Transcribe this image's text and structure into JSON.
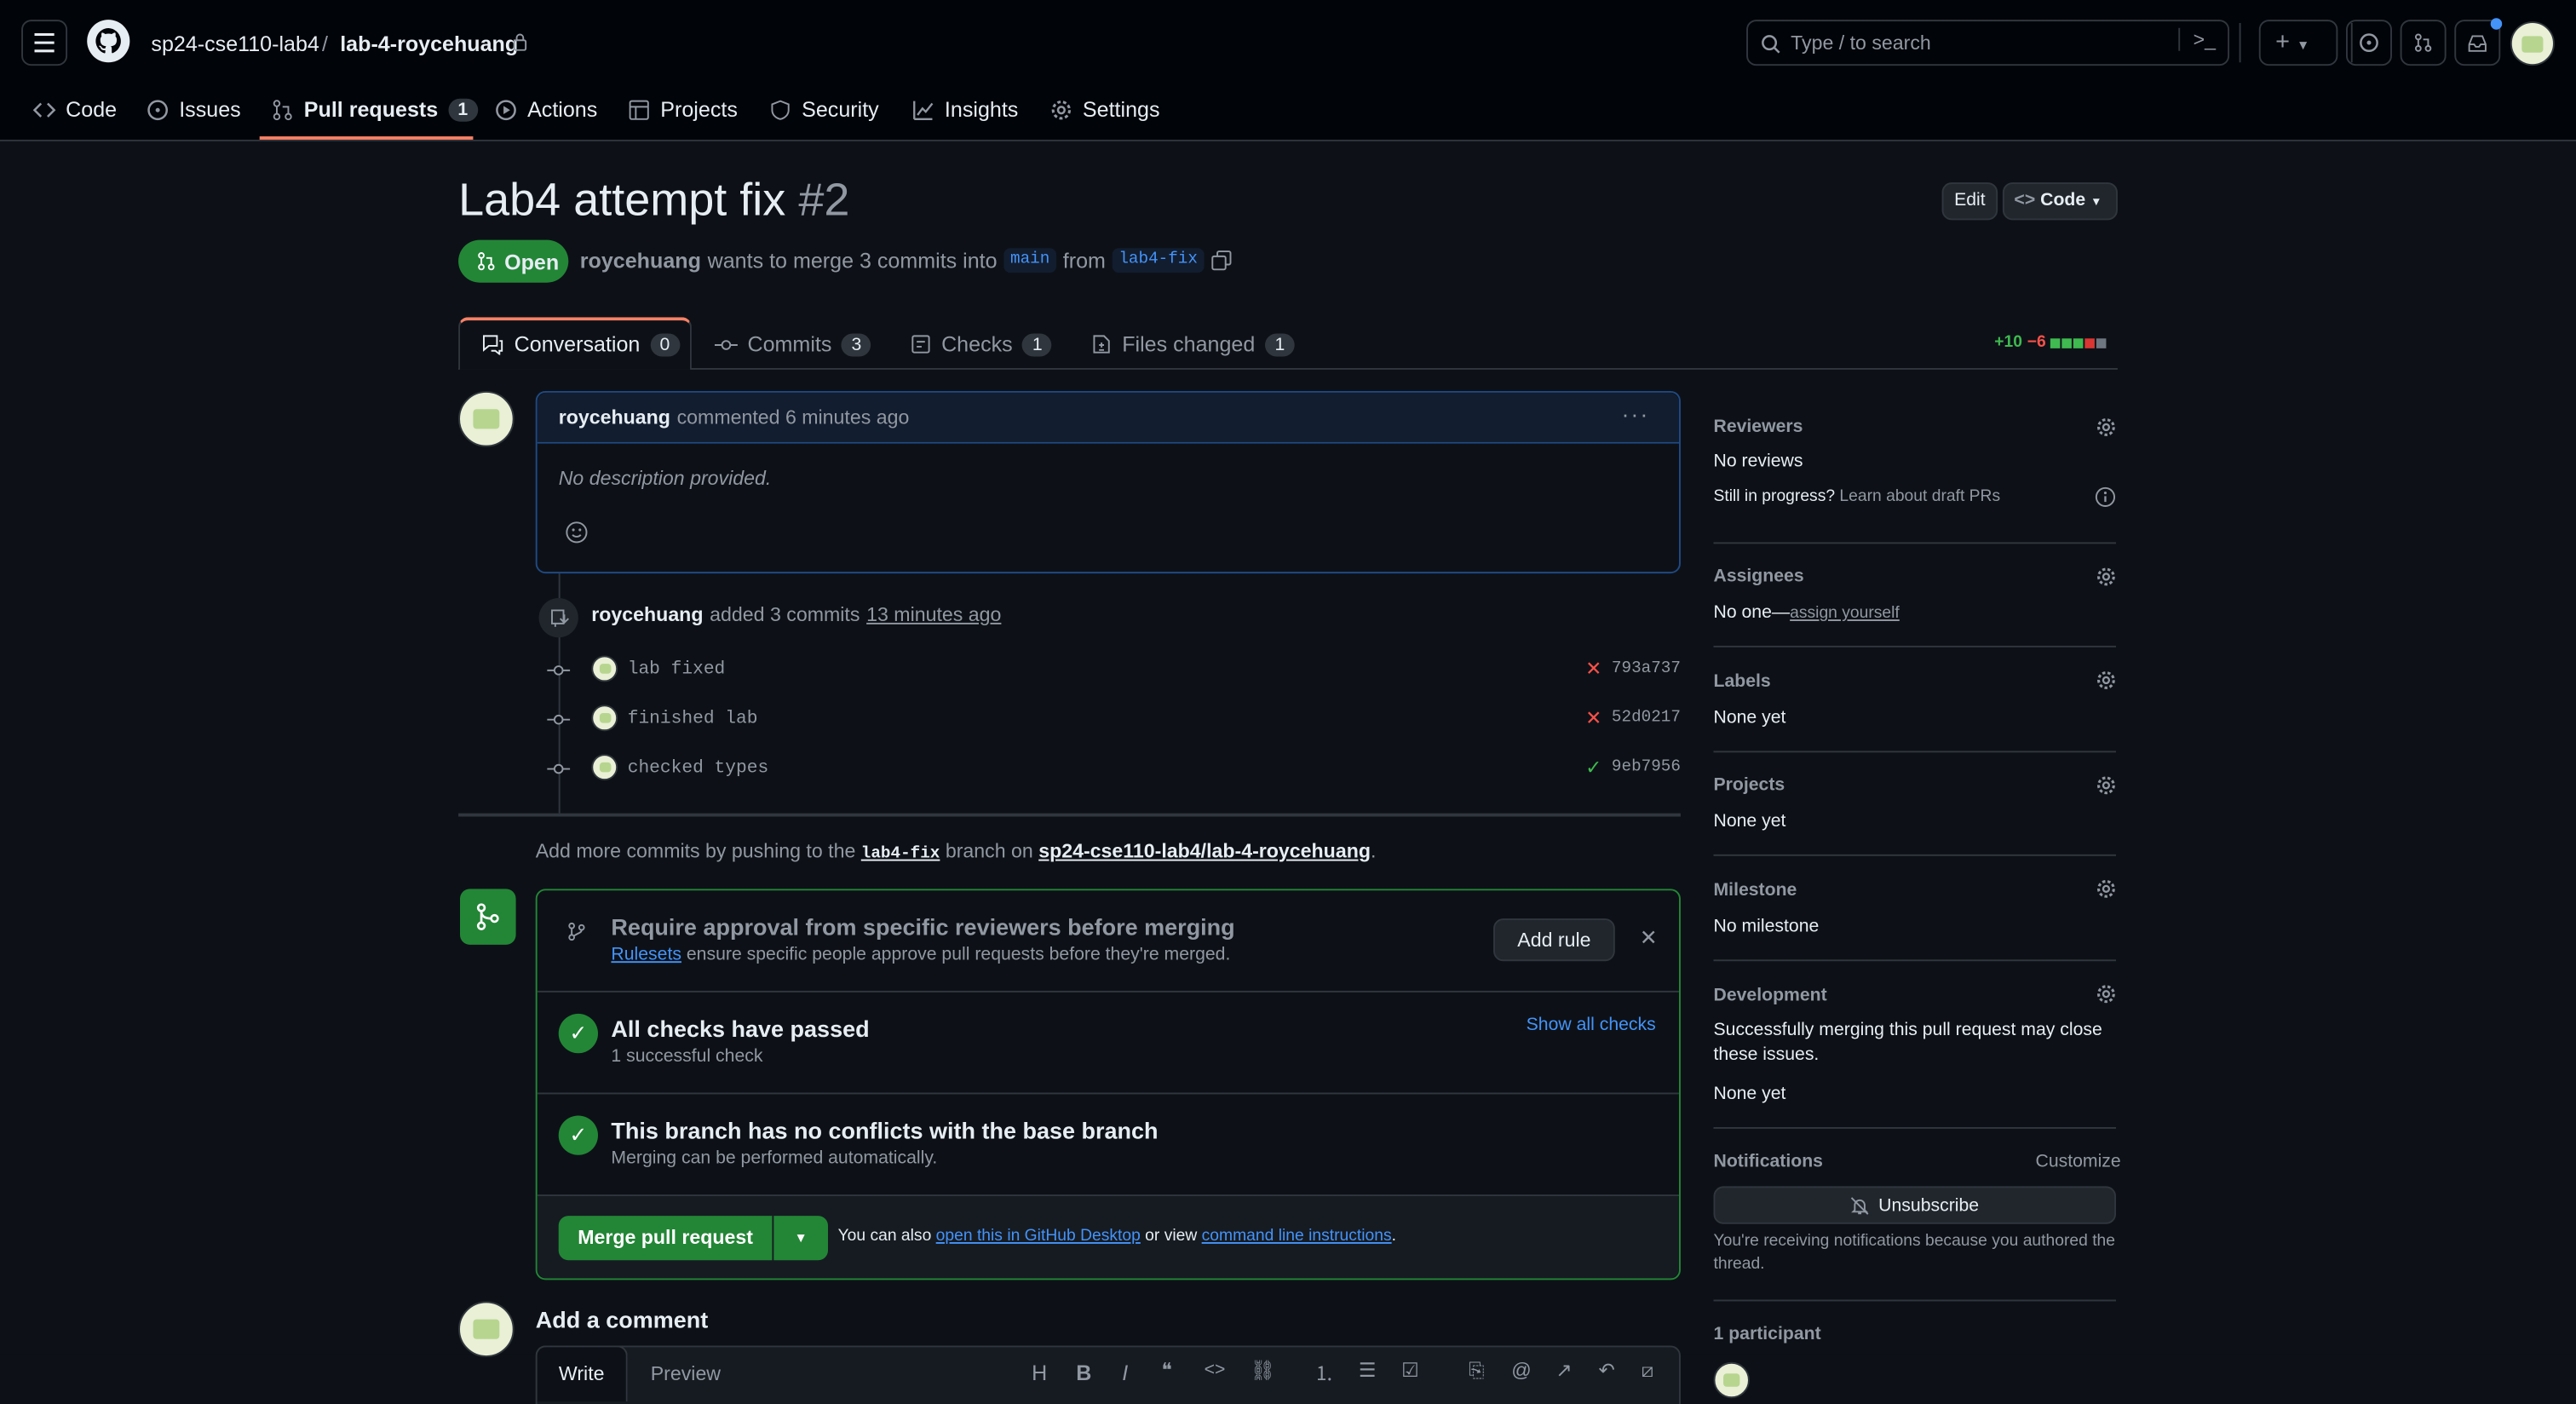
{
  "nav": {
    "owner": "sp24-cse110-lab4",
    "sep": "/",
    "repo": "lab-4-roycehuang",
    "search_text": "Type / to search"
  },
  "repo_tabs": [
    {
      "label": "Code"
    },
    {
      "label": "Issues"
    },
    {
      "label": "Pull requests",
      "count": "1"
    },
    {
      "label": "Actions"
    },
    {
      "label": "Projects"
    },
    {
      "label": "Security"
    },
    {
      "label": "Insights"
    },
    {
      "label": "Settings"
    }
  ],
  "pr": {
    "title": "Lab4 attempt fix",
    "number": "#2",
    "state": "Open",
    "author": "roycehuang",
    "merge_text": "wants to merge 3 commits into",
    "base": "main",
    "from": "from",
    "head": "lab4-fix",
    "edit_label": "Edit",
    "code_label": "Code"
  },
  "pr_tabs": [
    {
      "label": "Conversation",
      "count": "0"
    },
    {
      "label": "Commits",
      "count": "3"
    },
    {
      "label": "Checks",
      "count": "1"
    },
    {
      "label": "Files changed",
      "count": "1"
    }
  ],
  "diffstat": {
    "add": "+10",
    "del": "−6"
  },
  "comment": {
    "author": "roycehuang",
    "meta": "commented 6 minutes ago",
    "body": "No description provided."
  },
  "commits_event": {
    "author": "roycehuang",
    "text": "added 3 commits",
    "time": "13 minutes ago"
  },
  "commits": [
    {
      "msg": "lab fixed",
      "sha": "793a737",
      "status": "fail"
    },
    {
      "msg": "finished lab",
      "sha": "52d0217",
      "status": "fail"
    },
    {
      "msg": "checked types",
      "sha": "9eb7956",
      "status": "pass"
    }
  ],
  "push_hint": {
    "pre": "Add more commits by pushing to the",
    "branch": "lab4-fix",
    "mid": "branch on",
    "repo": "sp24-cse110-lab4/lab-4-roycehuang",
    "end": "."
  },
  "merge_box": {
    "rule_title": "Require approval from specific reviewers before merging",
    "rule_link": "Rulesets",
    "rule_desc": "ensure specific people approve pull requests before they're merged.",
    "add_rule": "Add rule",
    "checks_title": "All checks have passed",
    "checks_sub": "1 successful check",
    "show_checks": "Show all checks",
    "conflict_title": "This branch has no conflicts with the base branch",
    "conflict_sub": "Merging can be performed automatically.",
    "merge_btn": "Merge pull request",
    "also": "You can also",
    "desktop": "open this in GitHub Desktop",
    "or_view": "or view",
    "cli": "command line instructions",
    "dot": "."
  },
  "add_comment": {
    "title": "Add a comment",
    "write": "Write",
    "preview": "Preview"
  },
  "sidebar": {
    "reviewers": "Reviewers",
    "no_reviews": "No reviews",
    "still": "Still in progress?",
    "draft": "Learn about draft PRs",
    "assignees": "Assignees",
    "no_one": "No one—",
    "assign": "assign yourself",
    "labels": "Labels",
    "none_yet": "None yet",
    "projects": "Projects",
    "milestone": "Milestone",
    "no_milestone": "No milestone",
    "development": "Development",
    "dev_text": "Successfully merging this pull request may close these issues.",
    "notifications": "Notifications",
    "customize": "Customize",
    "unsubscribe": "Unsubscribe",
    "notif_reason": "You're receiving notifications because you authored the thread.",
    "participants": "1 participant"
  }
}
